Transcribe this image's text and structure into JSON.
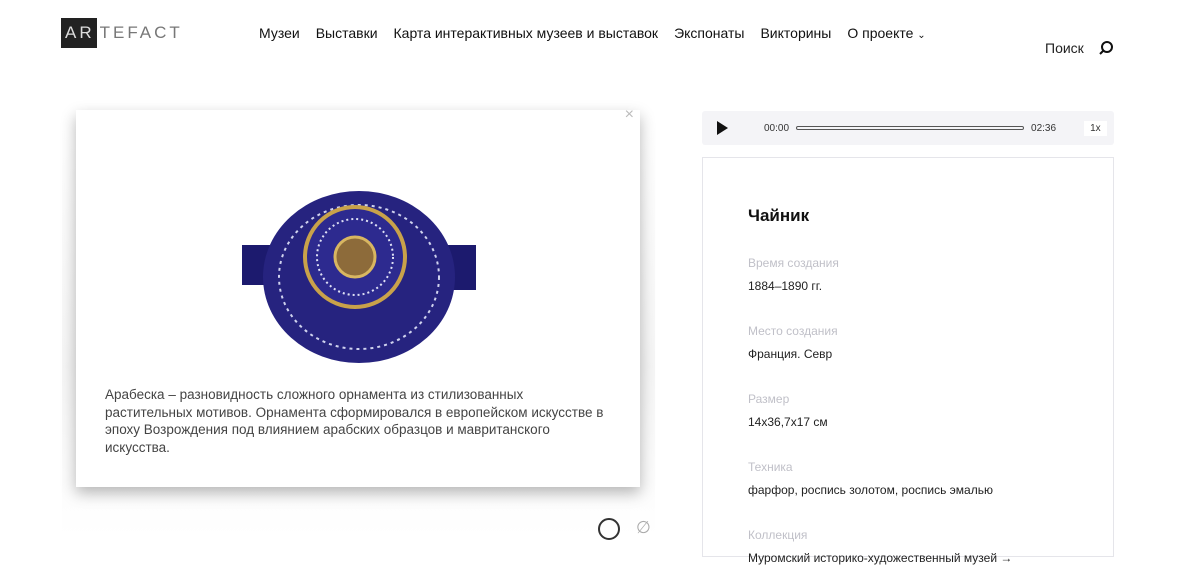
{
  "logo": {
    "boxed": "AR",
    "rest": "TEFACT"
  },
  "nav": [
    "Музеи",
    "Выставки",
    "Карта интерактивных музеев и выставок",
    "Экспонаты",
    "Викторины",
    "О проекте"
  ],
  "search_label": "Поиск",
  "popup": {
    "close": "×",
    "caption": "Арабеска – разновидность сложного орнамента из стилизованных растительных мотивов. Орнамента сформировался в европейском искусстве в эпоху Возрождения под влиянием арабских образцов и мавританского искусства."
  },
  "player": {
    "current": "00:00",
    "duration": "02:36",
    "speed": "1x",
    "progress": 0
  },
  "exhibit": {
    "title": "Чайник",
    "fields": [
      {
        "label": "Время создания",
        "value": "1884–1890 гг."
      },
      {
        "label": "Место создания",
        "value": "Франция. Севр"
      },
      {
        "label": "Размер",
        "value": "14х36,7х17 см"
      },
      {
        "label": "Техника",
        "value": "фарфор, роспись золотом, роспись эмалью"
      },
      {
        "label": "Коллекция",
        "value": "Муромский историко-художественный музей →"
      }
    ]
  }
}
